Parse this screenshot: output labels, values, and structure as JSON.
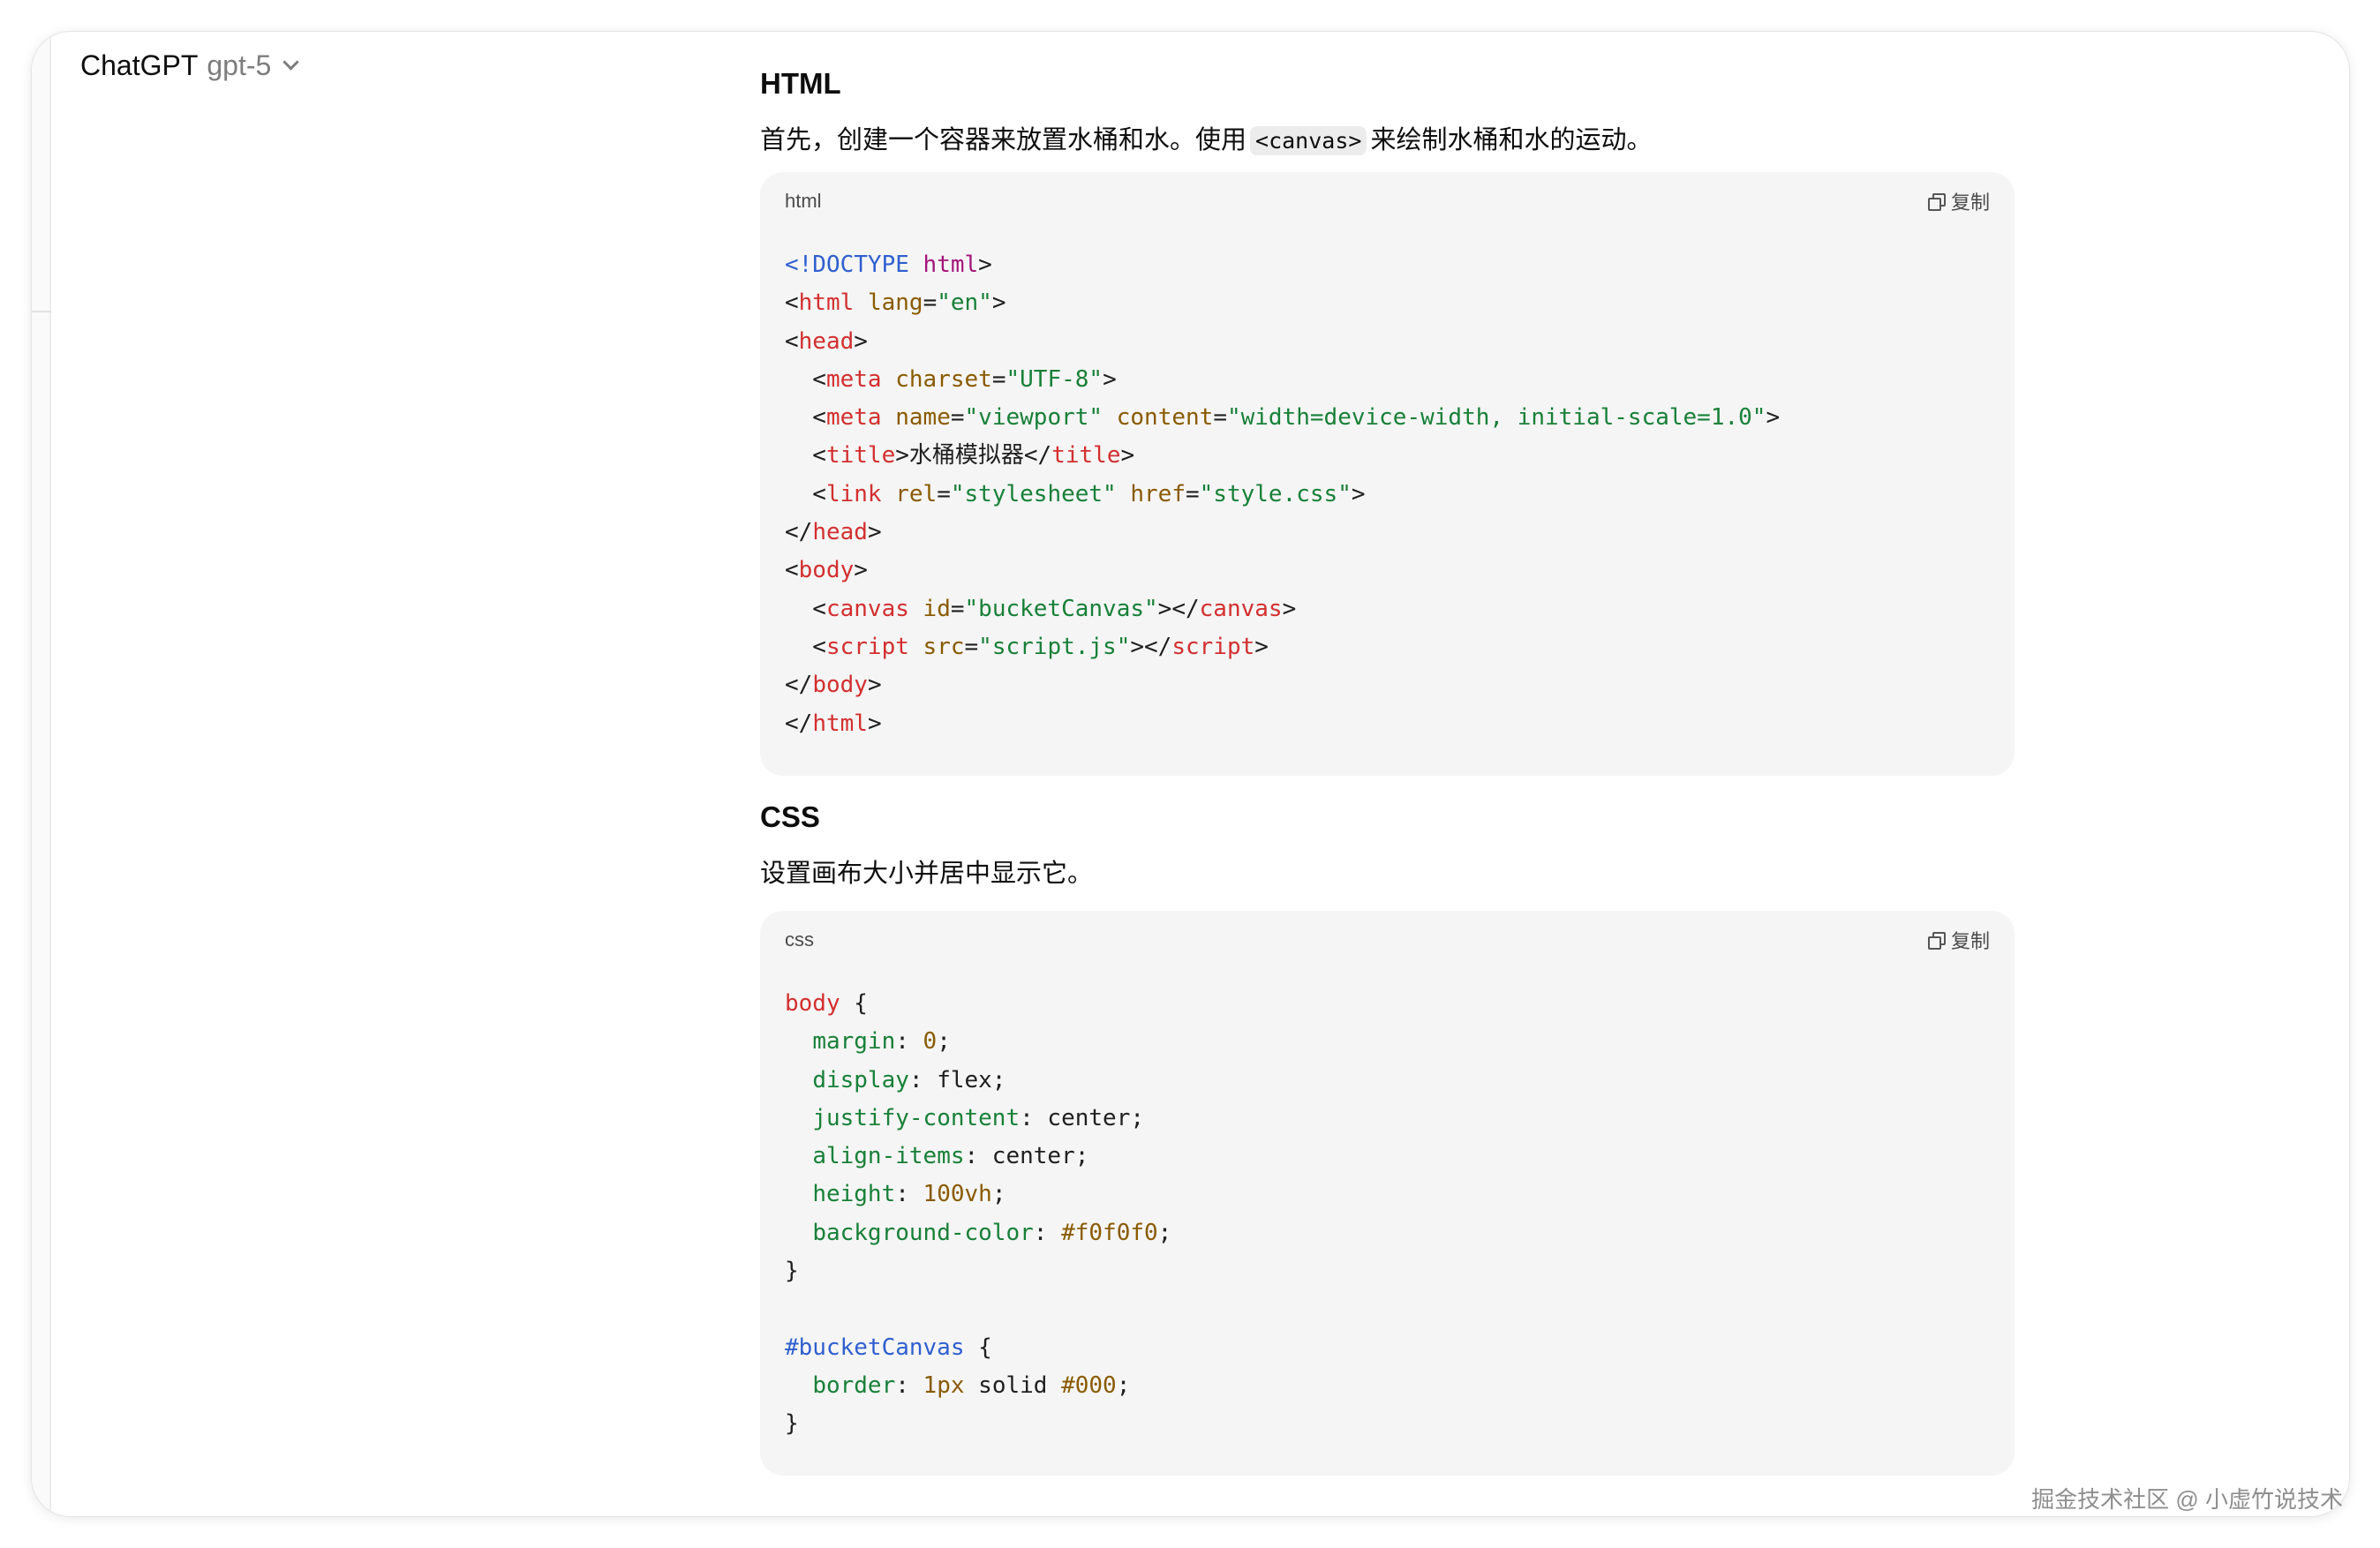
{
  "header": {
    "app_name": "ChatGPT",
    "model_name": "gpt-5"
  },
  "html_section": {
    "heading": "HTML",
    "intro_before": "首先，创建一个容器来放置水桶和水。使用",
    "intro_code": "<canvas>",
    "intro_after": "来绘制水桶和水的运动。",
    "code_language": "html",
    "copy_label": "复制",
    "code_lines": [
      [
        [
          "doc",
          "<!DOCTYPE "
        ],
        [
          "doc-kw",
          "html"
        ],
        [
          "plain",
          ">"
        ]
      ],
      [
        [
          "plain",
          "<"
        ],
        [
          "tag",
          "html"
        ],
        [
          "plain",
          " "
        ],
        [
          "attr",
          "lang"
        ],
        [
          "plain",
          "="
        ],
        [
          "str",
          "\"en\""
        ],
        [
          "plain",
          ">"
        ]
      ],
      [
        [
          "plain",
          "<"
        ],
        [
          "tag",
          "head"
        ],
        [
          "plain",
          ">"
        ]
      ],
      [
        [
          "plain",
          "  <"
        ],
        [
          "tag",
          "meta"
        ],
        [
          "plain",
          " "
        ],
        [
          "attr",
          "charset"
        ],
        [
          "plain",
          "="
        ],
        [
          "str",
          "\"UTF-8\""
        ],
        [
          "plain",
          ">"
        ]
      ],
      [
        [
          "plain",
          "  <"
        ],
        [
          "tag",
          "meta"
        ],
        [
          "plain",
          " "
        ],
        [
          "attr",
          "name"
        ],
        [
          "plain",
          "="
        ],
        [
          "str",
          "\"viewport\""
        ],
        [
          "plain",
          " "
        ],
        [
          "attr",
          "content"
        ],
        [
          "plain",
          "="
        ],
        [
          "str",
          "\"width=device-width, initial-scale=1.0\""
        ],
        [
          "plain",
          ">"
        ]
      ],
      [
        [
          "plain",
          "  <"
        ],
        [
          "tag",
          "title"
        ],
        [
          "plain",
          ">水桶模拟器</"
        ],
        [
          "tag",
          "title"
        ],
        [
          "plain",
          ">"
        ]
      ],
      [
        [
          "plain",
          "  <"
        ],
        [
          "tag",
          "link"
        ],
        [
          "plain",
          " "
        ],
        [
          "attr",
          "rel"
        ],
        [
          "plain",
          "="
        ],
        [
          "str",
          "\"stylesheet\""
        ],
        [
          "plain",
          " "
        ],
        [
          "attr",
          "href"
        ],
        [
          "plain",
          "="
        ],
        [
          "str",
          "\"style.css\""
        ],
        [
          "plain",
          ">"
        ]
      ],
      [
        [
          "plain",
          "</"
        ],
        [
          "tag",
          "head"
        ],
        [
          "plain",
          ">"
        ]
      ],
      [
        [
          "plain",
          "<"
        ],
        [
          "tag",
          "body"
        ],
        [
          "plain",
          ">"
        ]
      ],
      [
        [
          "plain",
          "  <"
        ],
        [
          "tag",
          "canvas"
        ],
        [
          "plain",
          " "
        ],
        [
          "attr",
          "id"
        ],
        [
          "plain",
          "="
        ],
        [
          "str",
          "\"bucketCanvas\""
        ],
        [
          "plain",
          "></"
        ],
        [
          "tag",
          "canvas"
        ],
        [
          "plain",
          ">"
        ]
      ],
      [
        [
          "plain",
          "  <"
        ],
        [
          "tag",
          "script"
        ],
        [
          "plain",
          " "
        ],
        [
          "attr",
          "src"
        ],
        [
          "plain",
          "="
        ],
        [
          "str",
          "\"script.js\""
        ],
        [
          "plain",
          "></"
        ],
        [
          "tag",
          "script"
        ],
        [
          "plain",
          ">"
        ]
      ],
      [
        [
          "plain",
          "</"
        ],
        [
          "tag",
          "body"
        ],
        [
          "plain",
          ">"
        ]
      ],
      [
        [
          "plain",
          "</"
        ],
        [
          "tag",
          "html"
        ],
        [
          "plain",
          ">"
        ]
      ]
    ]
  },
  "css_section": {
    "heading": "CSS",
    "intro": "设置画布大小并居中显示它。",
    "code_language": "css",
    "copy_label": "复制",
    "code_lines": [
      [
        [
          "sel",
          "body"
        ],
        [
          "plain",
          " {"
        ]
      ],
      [
        [
          "plain",
          "  "
        ],
        [
          "prop",
          "margin"
        ],
        [
          "plain",
          ": "
        ],
        [
          "num",
          "0"
        ],
        [
          "plain",
          ";"
        ]
      ],
      [
        [
          "plain",
          "  "
        ],
        [
          "prop",
          "display"
        ],
        [
          "plain",
          ": flex;"
        ]
      ],
      [
        [
          "plain",
          "  "
        ],
        [
          "prop",
          "justify-content"
        ],
        [
          "plain",
          ": center;"
        ]
      ],
      [
        [
          "plain",
          "  "
        ],
        [
          "prop",
          "align-items"
        ],
        [
          "plain",
          ": center;"
        ]
      ],
      [
        [
          "plain",
          "  "
        ],
        [
          "prop",
          "height"
        ],
        [
          "plain",
          ": "
        ],
        [
          "num",
          "100vh"
        ],
        [
          "plain",
          ";"
        ]
      ],
      [
        [
          "plain",
          "  "
        ],
        [
          "prop",
          "background-color"
        ],
        [
          "plain",
          ": "
        ],
        [
          "num",
          "#f0f0f0"
        ],
        [
          "plain",
          ";"
        ]
      ],
      [
        [
          "plain",
          "}"
        ]
      ],
      [
        [
          "plain",
          ""
        ]
      ],
      [
        [
          "id",
          "#bucketCanvas"
        ],
        [
          "plain",
          " {"
        ]
      ],
      [
        [
          "plain",
          "  "
        ],
        [
          "prop",
          "border"
        ],
        [
          "plain",
          ": "
        ],
        [
          "num",
          "1px"
        ],
        [
          "plain",
          " solid "
        ],
        [
          "num",
          "#000"
        ],
        [
          "plain",
          ";"
        ]
      ],
      [
        [
          "plain",
          "}"
        ]
      ]
    ]
  },
  "watermark": "掘金技术社区 @ 小虚竹说技术",
  "colors": {
    "code_background": "#f5f5f5",
    "tag": "#d32f2f",
    "attribute": "#8a5a00",
    "string": "#188038",
    "doctype": "#2f5fcf"
  }
}
